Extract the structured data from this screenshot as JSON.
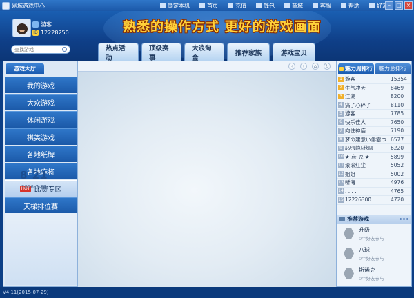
{
  "app": {
    "title": "网城游戏中心"
  },
  "top_menu": [
    "锁定本机",
    "首页",
    "充值",
    "钱包",
    "商城",
    "客服",
    "帮助",
    "好友"
  ],
  "window_controls": {
    "minimize": "–",
    "restore": "□",
    "close": "×"
  },
  "header": {
    "slogan": "熟悉的操作方式 更好的游戏画面"
  },
  "user": {
    "nickname": "游客",
    "id_tag": "ID",
    "id": "12228250"
  },
  "search": {
    "placeholder": "查找游戏"
  },
  "top_tabs": [
    "热点活动",
    "顶级赛事",
    "大浪淘金",
    "推荐家族",
    "游戏宝贝"
  ],
  "lobby_tab": "游戏大厅",
  "left_menu": [
    "我的游戏",
    "大众游戏",
    "休闲游戏",
    "棋类游戏",
    "各地纸牌",
    "各地麻将",
    "比赛专区",
    "天梯排位赛"
  ],
  "hot_badge": "HOT",
  "clock": {
    "time": "8 21",
    "date": "2016-7-27"
  },
  "rank_tabs": [
    "魅力周排行",
    "魅力总排行"
  ],
  "rank_list": [
    {
      "no": "1",
      "name": "游客",
      "score": "15354"
    },
    {
      "no": "2",
      "name": "牛气冲天",
      "score": "8469"
    },
    {
      "no": "3",
      "name": "江湖",
      "score": "8200"
    },
    {
      "no": "4",
      "name": "痛了心碎了",
      "score": "8110"
    },
    {
      "no": "5",
      "name": "游客",
      "score": "7785"
    },
    {
      "no": "6",
      "name": "快乐佳人",
      "score": "7650"
    },
    {
      "no": "7",
      "name": "向往神庙",
      "score": "7190"
    },
    {
      "no": "8",
      "name": "梦の建意い俳霎つ",
      "score": "6577"
    },
    {
      "no": "9",
      "name": "ﾙ火ﾙ静ﾙ秋ﾙﾙ",
      "score": "6220"
    },
    {
      "no": "10",
      "name": "★ 彦 児 ★",
      "score": "5899"
    },
    {
      "no": "11",
      "name": "滚滚红尘",
      "score": "5052"
    },
    {
      "no": "12",
      "name": "姐姐",
      "score": "5002"
    },
    {
      "no": "13",
      "name": "      听海",
      "score": "4976"
    },
    {
      "no": "14",
      "name": "      . . . .",
      "score": "4765"
    },
    {
      "no": "15",
      "name": "12226300",
      "score": "4720"
    }
  ],
  "recommended": {
    "title": "推荐游戏",
    "items": [
      {
        "name": "升级",
        "sub": "0个好友参与"
      },
      {
        "name": "八球",
        "sub": "0个好友参与"
      },
      {
        "name": "斯诺克",
        "sub": "0个好友参与"
      }
    ]
  },
  "status": {
    "version": "V4.11(2015-07-29)"
  }
}
